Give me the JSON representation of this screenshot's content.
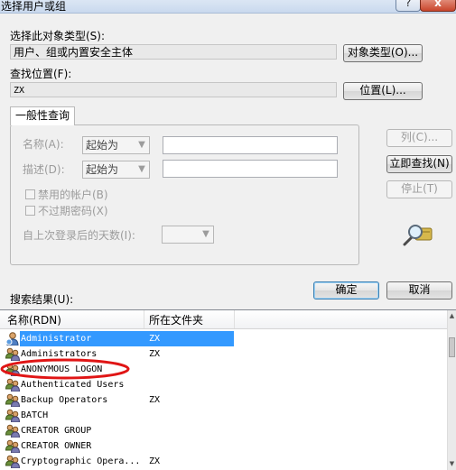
{
  "window": {
    "title": "选择用户或组",
    "help": "?",
    "close": "x"
  },
  "object_type": {
    "label": "选择此对象类型(S):",
    "value": "用户、组或内置安全主体",
    "button": "对象类型(O)..."
  },
  "location": {
    "label": "查找位置(F):",
    "value": "ZX",
    "button": "位置(L)..."
  },
  "common_query": {
    "tab": "一般性查询",
    "name_label": "名称(A):",
    "name_mode": "起始为",
    "desc_label": "描述(D):",
    "desc_mode": "起始为",
    "disabled_accounts": "禁用的帐户(B)",
    "non_expiring_pwd": "不过期密码(X)",
    "days_label": "自上次登录后的天数(I):"
  },
  "side_buttons": {
    "columns": "列(C)...",
    "find_now": "立即查找(N)",
    "stop": "停止(T)"
  },
  "dialog_buttons": {
    "ok": "确定",
    "cancel": "取消"
  },
  "results": {
    "label": "搜索结果(U):",
    "columns": [
      "名称(RDN)",
      "所在文件夹"
    ],
    "rows": [
      {
        "name": "Administrator",
        "folder": "ZX",
        "selected": true,
        "icon": "user-icon"
      },
      {
        "name": "Administrators",
        "folder": "ZX",
        "icon": "group-icon"
      },
      {
        "name": "ANONYMOUS LOGON",
        "folder": "",
        "icon": "group-icon",
        "highlight": true
      },
      {
        "name": "Authenticated Users",
        "folder": "",
        "icon": "group-icon"
      },
      {
        "name": "Backup Operators",
        "folder": "ZX",
        "icon": "group-icon"
      },
      {
        "name": "BATCH",
        "folder": "",
        "icon": "group-icon"
      },
      {
        "name": "CREATOR GROUP",
        "folder": "",
        "icon": "group-icon"
      },
      {
        "name": "CREATOR OWNER",
        "folder": "",
        "icon": "group-icon"
      },
      {
        "name": "Cryptographic Opera...",
        "folder": "ZX",
        "icon": "group-icon"
      }
    ]
  },
  "colors": {
    "selection": "#3399ff",
    "annotation": "#e01515"
  }
}
